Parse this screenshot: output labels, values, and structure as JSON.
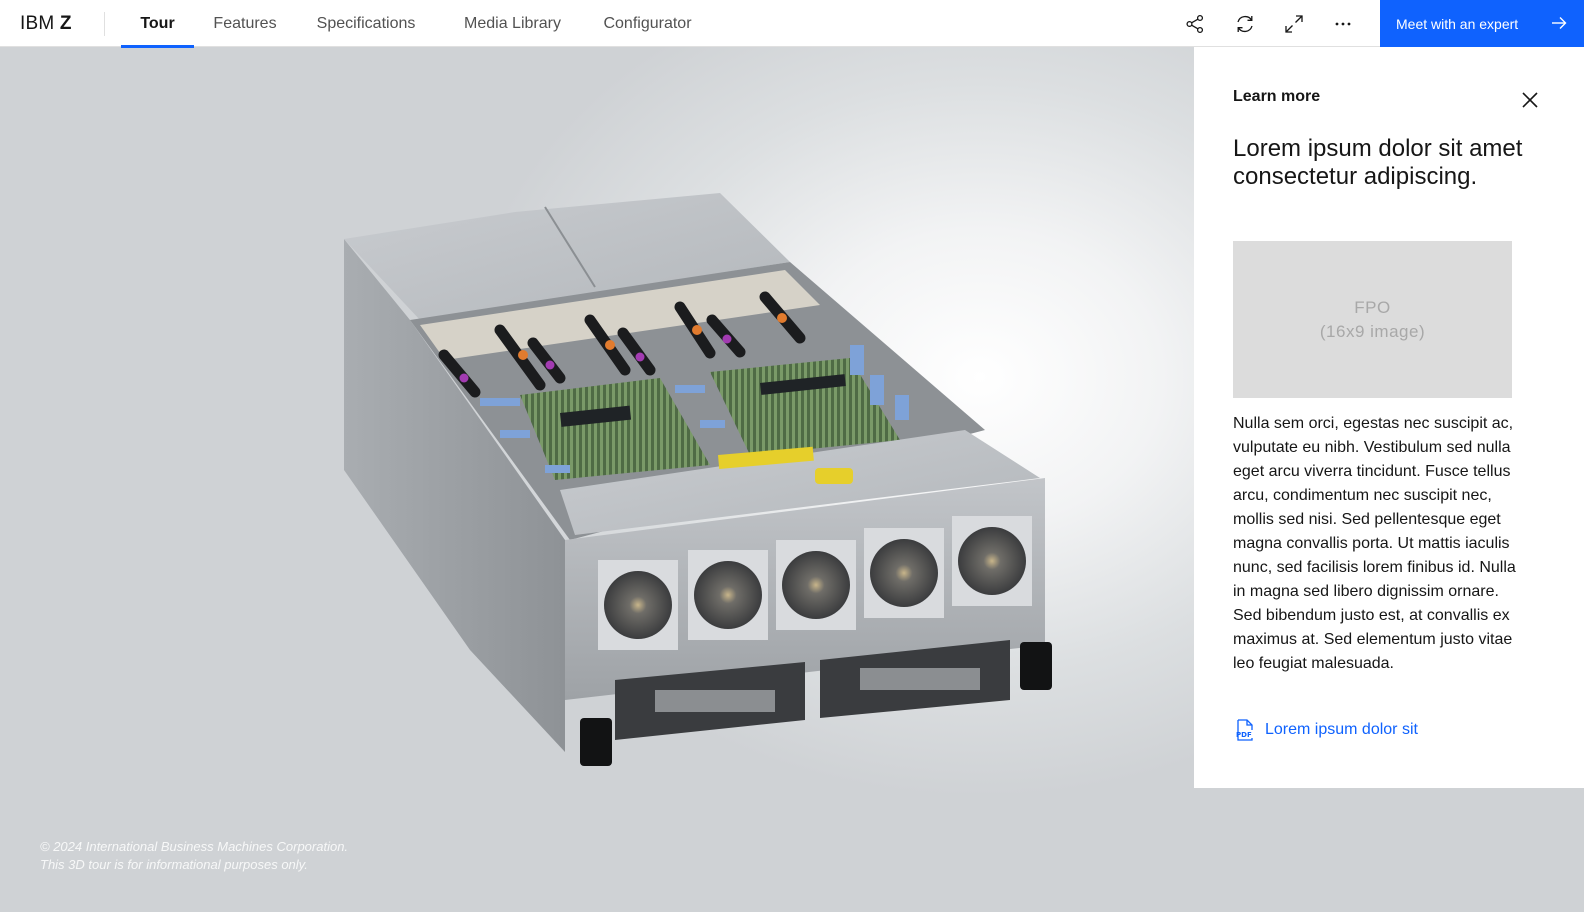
{
  "header": {
    "brand_regular": "IBM ",
    "brand_bold": "Z",
    "tabs": [
      {
        "label": "Tour",
        "active": true
      },
      {
        "label": "Features",
        "active": false
      },
      {
        "label": "Specifications",
        "active": false
      },
      {
        "label": "Media Library",
        "active": false
      },
      {
        "label": "Configurator",
        "active": false
      }
    ],
    "tools": [
      "share-icon",
      "rotate-icon",
      "maximize-icon",
      "overflow-menu-icon"
    ],
    "cta_label": "Meet with an expert",
    "accent_color": "#0f62fe"
  },
  "panel": {
    "eyebrow": "Learn more",
    "title": "Lorem ipsum dolor sit amet consectetur adipiscing.",
    "image_placeholder_line1": "FPO",
    "image_placeholder_line2": "(16x9 image)",
    "body": "Nulla sem orci, egestas nec suscipit ac, vulputate eu nibh. Vestibulum sed nulla eget arcu viverra tincidunt. Fusce tellus arcu, condimentum nec suscipit nec, mollis sed nisi. Sed pellentesque eget magna convallis porta. Ut mattis iaculis nunc, sed facilisis lorem finibus id. Nulla in magna sed libero dignissim ornare. Sed bibendum justo est, at convallis ex maximus at. Sed elementum justo vitae leo feugiat malesuada.",
    "link_label": "Lorem ipsum dolor sit",
    "link_icon": "pdf-icon"
  },
  "footer": {
    "copyright_line1": "© 2024 International Business Machines Corporation.",
    "copyright_line2": "This 3D tour is for informational purposes only."
  }
}
